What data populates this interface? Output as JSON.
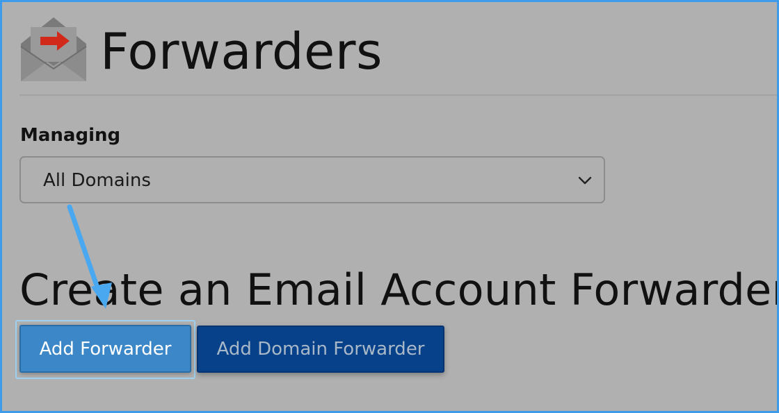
{
  "header": {
    "title": "Forwarders",
    "icon": "email-forward-icon"
  },
  "managing": {
    "label": "Managing",
    "selected": "All Domains",
    "icon": "chevron-down-icon"
  },
  "create_section": {
    "heading": "Create an Email Account Forwarder",
    "add_forwarder_label": "Add Forwarder",
    "add_domain_forwarder_label": "Add Domain Forwarder"
  },
  "colors": {
    "frame_border": "#3d9be9",
    "background": "#b0b0b0",
    "primary_button": "#3c87c7",
    "secondary_button": "#064189",
    "arrow": "#4aa8f0",
    "icon_accent": "#d12a1a"
  },
  "annotation": {
    "icon": "arrow-pointer-icon"
  }
}
